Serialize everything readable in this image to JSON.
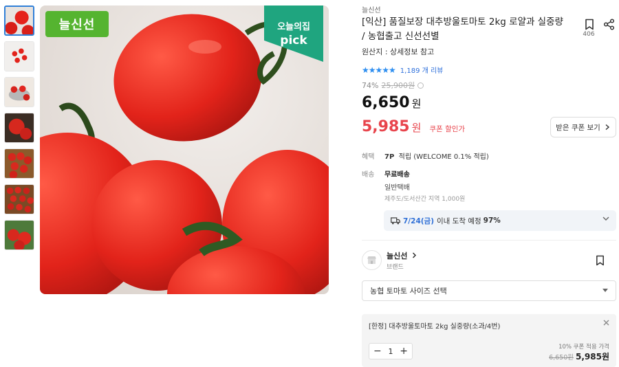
{
  "badges": {
    "brand": "늘신선",
    "pick_line1": "오늘의집",
    "pick_line2": "pick"
  },
  "product": {
    "seller": "늘신선",
    "title": "[익산] 품질보장 대추방울토마토 2kg 로얄과 실중량 / 농협출고 신선선별",
    "origin": "원산지 : 상세정보 참고",
    "bookmark_count": "406",
    "rating_stars": "★★★★★",
    "review_count": "1,189 개 리뷰",
    "discount_rate": "74%",
    "original_price": "25,900원",
    "price": "6,650",
    "price_unit": "원",
    "coupon_price": "5,985",
    "coupon_price_unit": "원",
    "coupon_tag": "쿠폰 할인가",
    "coupon_button": "받은 쿠폰 보기"
  },
  "benefit": {
    "label": "혜택",
    "points": "7P",
    "text": "적립 (WELCOME 0.1% 적립)"
  },
  "shipping": {
    "label": "배송",
    "fee": "무료배송",
    "type": "일반택배",
    "extra": "제주도/도서산간 지역 1,000원",
    "arrival_date": "7/24(금)",
    "arrival_text": "이내 도착 예정",
    "arrival_rate": "97%"
  },
  "store": {
    "name": "늘신선",
    "sub": "브랜드"
  },
  "option_select": {
    "placeholder": "농협 토마토 사이즈 선택"
  },
  "selected_option": {
    "name": "[한정] 대추방울토마토 2kg 실중량(소과/4번)",
    "quantity": "1",
    "coupon_label": "10% 쿠폰 적용 가격",
    "original_price": "6,650원",
    "final_price": "5,985원"
  },
  "colors": {
    "accent_blue": "#2f6fd6",
    "coupon_red": "#e8444c",
    "brand_green": "#55b430",
    "pick_green": "#1fa57f"
  }
}
